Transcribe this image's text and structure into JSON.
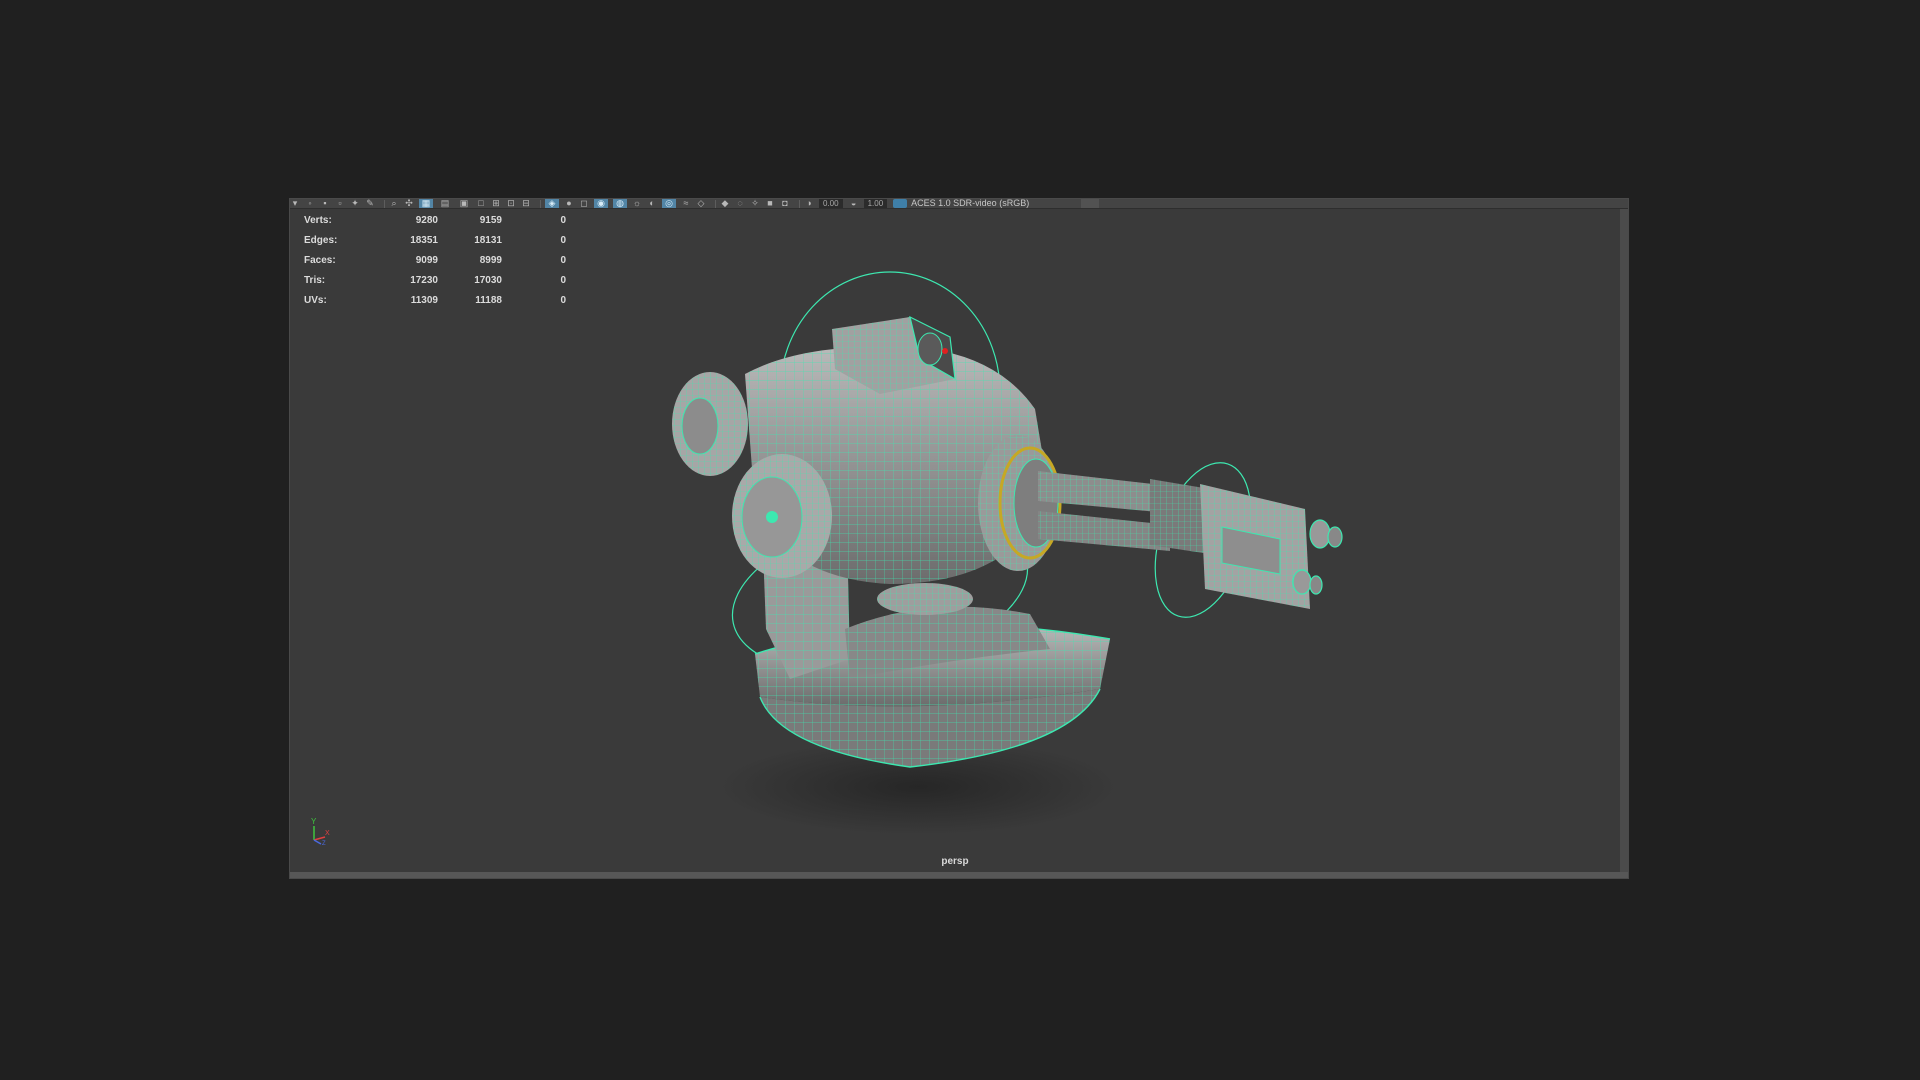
{
  "toolbar": {
    "icons": [
      "grid-icon",
      "lasso-icon",
      "camera-icon",
      "bookmark-icon",
      "image-plane-icon",
      "two-d-pan-icon",
      "grease-pencil-icon",
      "wireframe-icon",
      "smooth-shade-icon",
      "bounding-box-icon",
      "textured-icon",
      "lights-icon",
      "shadows-icon",
      "ambient-occlusion-icon",
      "motion-blur-icon",
      "anti-alias-icon",
      "depth-of-field-icon",
      "isolate-select-icon",
      "xray-icon",
      "xray-joints-icon",
      "backface-icon",
      "resolution-gate-icon",
      "safe-action-icon",
      "gate-mask-icon",
      "field-chart-icon"
    ],
    "exposure_value": "0.00",
    "gamma_value": "1.00",
    "color_space": "ACES 1.0 SDR-video (sRGB)"
  },
  "hud": {
    "rows": [
      {
        "label": "Verts:",
        "total": "9280",
        "selected": "9159",
        "components": "0"
      },
      {
        "label": "Edges:",
        "total": "18351",
        "selected": "18131",
        "components": "0"
      },
      {
        "label": "Faces:",
        "total": "9099",
        "selected": "8999",
        "components": "0"
      },
      {
        "label": "Tris:",
        "total": "17230",
        "selected": "17030",
        "components": "0"
      },
      {
        "label": "UVs:",
        "total": "11309",
        "selected": "11188",
        "components": "0"
      }
    ]
  },
  "viewport": {
    "camera": "persp",
    "wire_color": "#3de8b0",
    "background_color": "#3a3a3a"
  },
  "axis": {
    "y": "Y",
    "x": "X",
    "z": "Z"
  }
}
